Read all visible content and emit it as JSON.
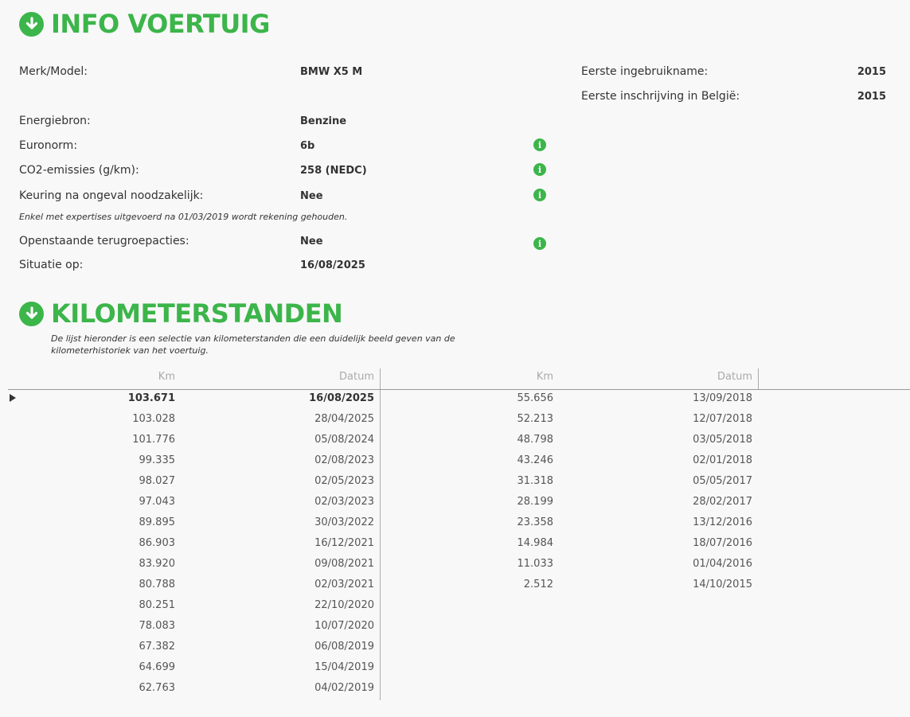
{
  "info": {
    "title": "INFO VOERTUIG",
    "fields": [
      {
        "label": "Merk/Model:",
        "value": "BMW X5 M"
      },
      {
        "label": "Energiebron:",
        "value": "Benzine"
      },
      {
        "label": "Euronorm:",
        "value": "6b"
      },
      {
        "label": "CO2-emissies (g/km):",
        "value": "258 (NEDC)"
      },
      {
        "label": "Keuring na ongeval noodzakelijk:",
        "value": "Nee"
      },
      {
        "label": "Openstaande terugroepacties:",
        "value": "Nee"
      },
      {
        "label": "Situatie op:",
        "value": "16/08/2025"
      }
    ],
    "note": "Enkel met expertises uitgevoerd na 01/03/2019 wordt rekening gehouden.",
    "right_fields": [
      {
        "label": "Eerste ingebruikname:",
        "value": "2015"
      },
      {
        "label": "Eerste inschrijving in België:",
        "value": "2015"
      }
    ],
    "info_icon": "info-icon"
  },
  "km": {
    "title": "KILOMETERSTANDEN",
    "intro": "De lijst hieronder is een selectie van kilometerstanden die een duidelijk beeld geven van de kilometerhistoriek van het voertuig.",
    "headers": {
      "km": "Km",
      "datum": "Datum"
    },
    "left_rows": [
      {
        "km": "103.671",
        "datum": "16/08/2025"
      },
      {
        "km": "103.028",
        "datum": "28/04/2025"
      },
      {
        "km": "101.776",
        "datum": "05/08/2024"
      },
      {
        "km": "99.335",
        "datum": "02/08/2023"
      },
      {
        "km": "98.027",
        "datum": "02/05/2023"
      },
      {
        "km": "97.043",
        "datum": "02/03/2023"
      },
      {
        "km": "89.895",
        "datum": "30/03/2022"
      },
      {
        "km": "86.903",
        "datum": "16/12/2021"
      },
      {
        "km": "83.920",
        "datum": "09/08/2021"
      },
      {
        "km": "80.788",
        "datum": "02/03/2021"
      },
      {
        "km": "80.251",
        "datum": "22/10/2020"
      },
      {
        "km": "78.083",
        "datum": "10/07/2020"
      },
      {
        "km": "67.382",
        "datum": "06/08/2019"
      },
      {
        "km": "64.699",
        "datum": "15/04/2019"
      },
      {
        "km": "62.763",
        "datum": "04/02/2019"
      }
    ],
    "right_rows": [
      {
        "km": "55.656",
        "datum": "13/09/2018"
      },
      {
        "km": "52.213",
        "datum": "12/07/2018"
      },
      {
        "km": "48.798",
        "datum": "03/05/2018"
      },
      {
        "km": "43.246",
        "datum": "02/01/2018"
      },
      {
        "km": "31.318",
        "datum": "05/05/2017"
      },
      {
        "km": "28.199",
        "datum": "28/02/2017"
      },
      {
        "km": "23.358",
        "datum": "13/12/2016"
      },
      {
        "km": "14.984",
        "datum": "18/07/2016"
      },
      {
        "km": "11.033",
        "datum": "01/04/2016"
      },
      {
        "km": "2.512",
        "datum": "14/10/2015"
      }
    ]
  },
  "colors": {
    "accent": "#3cb54a"
  }
}
